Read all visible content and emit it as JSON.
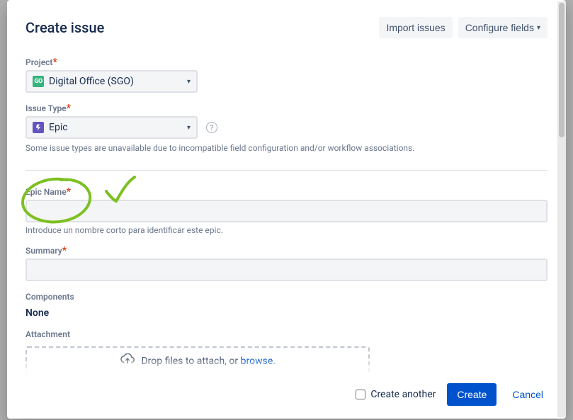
{
  "header": {
    "title": "Create issue",
    "import_btn": "Import issues",
    "configure_btn": "Configure fields"
  },
  "fields": {
    "project": {
      "label": "Project",
      "value": "Digital Office (SGO)",
      "icon_text": "GO"
    },
    "issue_type": {
      "label": "Issue Type",
      "value": "Epic",
      "note": "Some issue types are unavailable due to incompatible field configuration and/or workflow associations."
    },
    "epic_name": {
      "label": "Epic Name",
      "value": "",
      "help": "Introduce un nombre corto para identificar este epic."
    },
    "summary": {
      "label": "Summary",
      "value": ""
    },
    "components": {
      "label": "Components",
      "value": "None"
    },
    "attachment": {
      "label": "Attachment",
      "drop_text": "Drop files to attach, or ",
      "browse_text": "browse",
      "dot": "."
    }
  },
  "footer": {
    "create_another": "Create another",
    "create_btn": "Create",
    "cancel_btn": "Cancel"
  }
}
